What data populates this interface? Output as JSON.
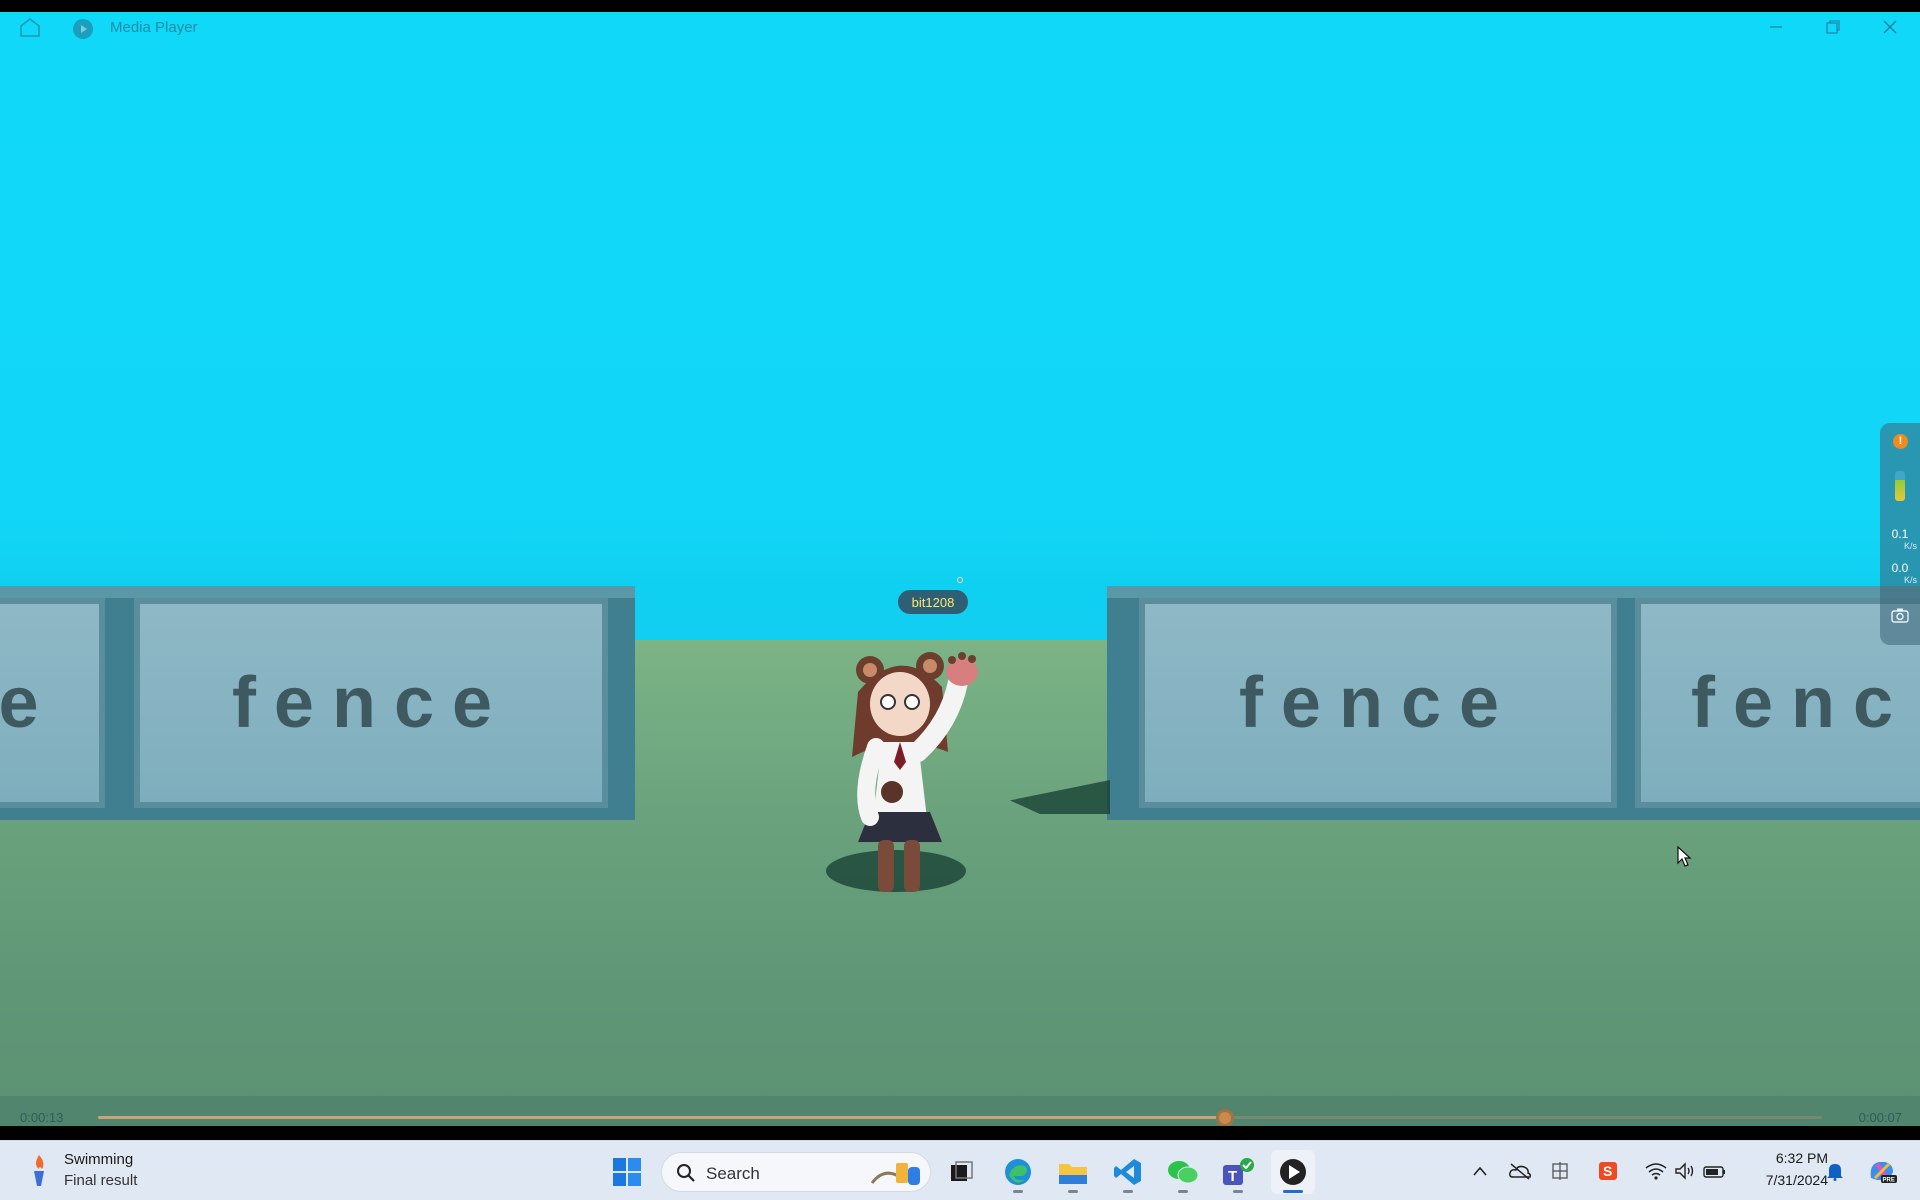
{
  "window": {
    "title": "Media Player",
    "buttons": {
      "minimize": "minimize-icon",
      "restore": "restore-icon",
      "close": "close-icon"
    }
  },
  "scene": {
    "fence_label": "fence",
    "fence_left_fragment": "e",
    "fence_right_fragment": "fenc",
    "username_tag": "bit1208"
  },
  "monitor": {
    "badge": "!",
    "upload_value": "0.1",
    "upload_unit": "K/s",
    "download_value": "0.0",
    "download_unit": "K/s"
  },
  "playback": {
    "elapsed": "0:00:13",
    "remaining": "0:00:07",
    "progress": 0.654
  },
  "taskbar": {
    "weather_title": "Swimming",
    "weather_subtitle": "Final result",
    "search_placeholder": "Search",
    "apps": [
      "start-icon",
      "search-icon",
      "task-view-icon",
      "edge-icon",
      "file-explorer-icon",
      "vscode-icon",
      "wechat-icon",
      "teams-icon",
      "media-player-icon"
    ],
    "tray": [
      "chevron-up-icon",
      "onedrive-icon",
      "ime-icon",
      "app-s-icon",
      "wifi-icon",
      "volume-icon",
      "battery-icon"
    ],
    "time": "6:32 PM",
    "date": "7/31/2024"
  },
  "colors": {
    "sky": "#10d8f8",
    "ground": "#6aa27d",
    "accent": "#c88b4c"
  }
}
